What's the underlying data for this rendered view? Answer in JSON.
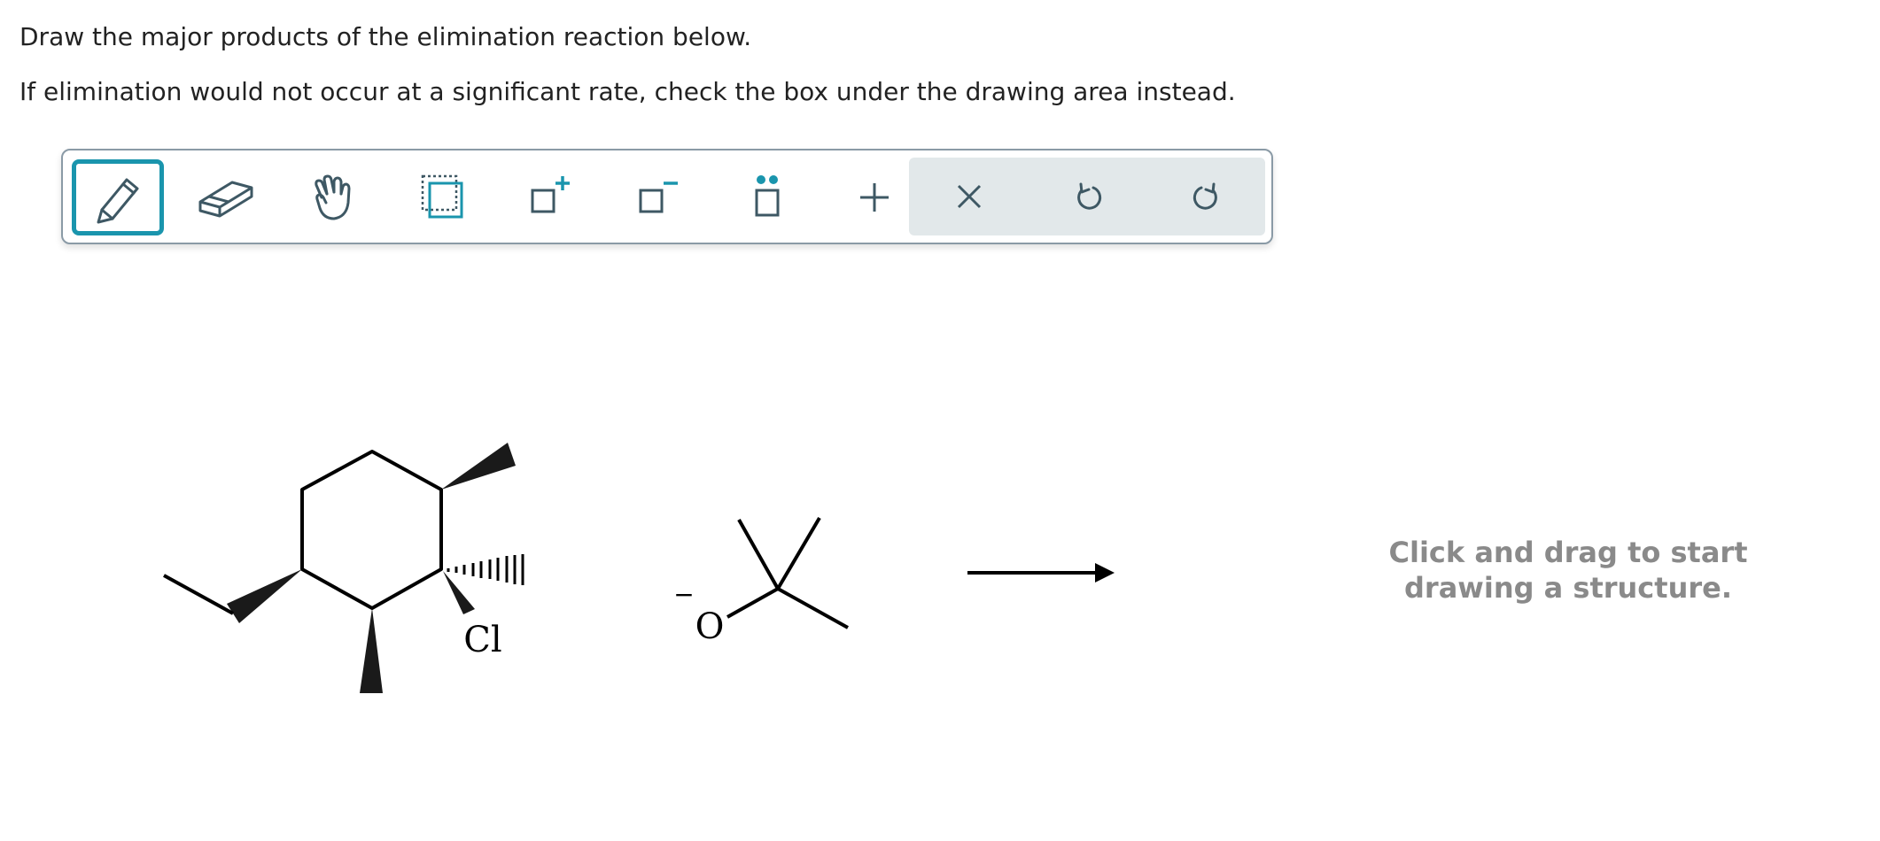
{
  "instructions": {
    "line1": "Draw the major products of the elimination reaction below.",
    "line2": "If elimination would not occur at a significant rate, check the box under the drawing area instead."
  },
  "toolbar": {
    "active_tool": "pencil-tool",
    "tools": [
      "pencil-tool",
      "eraser-tool",
      "hand-tool",
      "select-tool",
      "increase-charge-tool",
      "decrease-charge-tool",
      "lone-pair-tool",
      "add-tool"
    ],
    "actions": [
      "clear-tool",
      "undo-tool",
      "redo-tool"
    ]
  },
  "reaction": {
    "substrate_leaving_group": "Cl",
    "base_atom": "O",
    "base_charge": "−"
  },
  "drawing_area": {
    "hint_line1": "Click and drag to start",
    "hint_line2": "drawing a structure."
  },
  "colors": {
    "accent": "#1a95ad",
    "icon": "#3e5864",
    "action_bg": "#e2e8ea",
    "hint": "#8a8a8a"
  }
}
